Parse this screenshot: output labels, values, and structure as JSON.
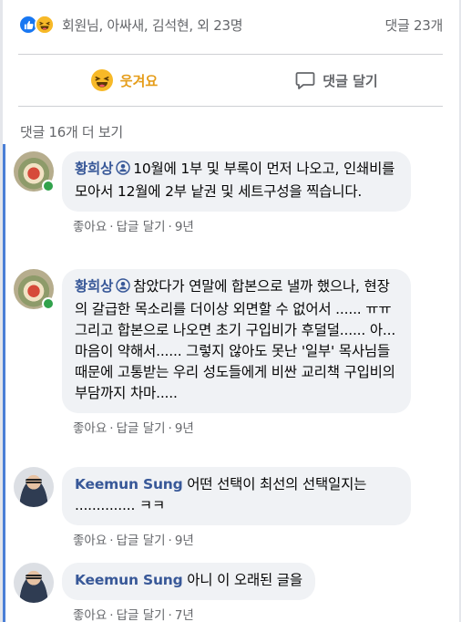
{
  "reactions": {
    "icons": [
      "like-icon",
      "haha-icon"
    ],
    "names": "회원님, 아싸새, 김석현, 외 23명",
    "comment_count": "댓글 23개"
  },
  "actions": {
    "laugh_label": "웃겨요",
    "comment_label": "댓글 달기"
  },
  "more_comments": "댓글 16개 더 보기",
  "meta_labels": {
    "like": "좋아요",
    "reply": "답글 달기",
    "sep": "·"
  },
  "colors": {
    "accent": "#385898",
    "laugh": "#e59d1a",
    "online": "#31a24c",
    "thread": "#4b7fd6",
    "bubble": "#f0f2f5"
  },
  "comments": [
    {
      "author": "황희상",
      "text": "10월에 1부 및 부록이 먼저 나오고, 인쇄비를 모아서 12월에 2부 낱권 및 세트구성을 찍습니다.",
      "time": "9년"
    },
    {
      "author": "황희상",
      "text": "참았다가 연말에 합본으로 낼까 했으나, 현장의 갈급한 목소리를 더이상 외면할 수 없어서 ...... ㅠㅠ 그리고 합본으로 나오면 초기 구입비가 후덜덜...... 아... 마음이 약해서...... 그렇지 않아도 못난 '일부' 목사님들 때문에 고통받는 우리 성도들에게 비싼 교리책 구입비의 부담까지 차마.....",
      "time": "9년"
    },
    {
      "author": "Keemun Sung",
      "text": "어떤 선택이 최선의 선택일지는 .............. ㅋㅋ",
      "time": "9년"
    },
    {
      "author": "Keemun Sung",
      "text": "아니 이 오래된 글을",
      "time": "7년"
    }
  ]
}
